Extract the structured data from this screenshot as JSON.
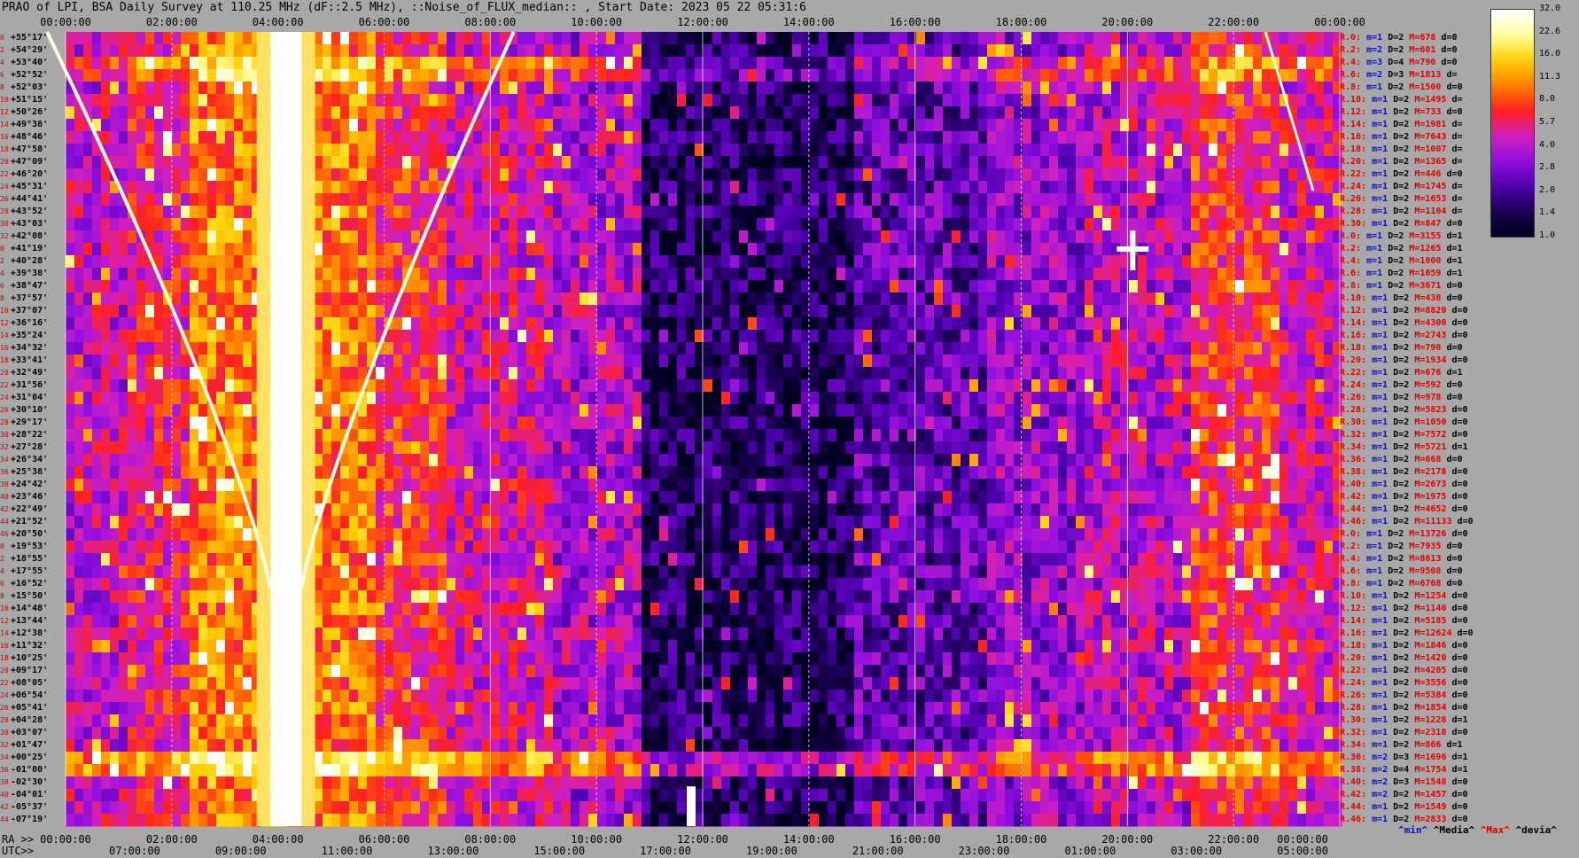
{
  "chart_data": {
    "type": "heatmap",
    "title": "PRAO of LPI, BSA Daily Survey at 110.25 MHz (dF::2.5 MHz), ::Noise_of_FLUX_median:: , Start Date: 2023 05 22 05:31:6",
    "x_top_ticks": [
      "00:00:00",
      "02:00:00",
      "04:00:00",
      "06:00:00",
      "08:00:00",
      "10:00:00",
      "12:00:00",
      "14:00:00",
      "16:00:00",
      "18:00:00",
      "20:00:00",
      "22:00:00",
      "00:00:00"
    ],
    "ra_axis_label": "RA >>",
    "ra_ticks": [
      "00:00:00",
      "02:00:00",
      "04:00:00",
      "06:00:00",
      "08:00:00",
      "10:00:00",
      "12:00:00",
      "14:00:00",
      "16:00:00",
      "18:00:00",
      "20:00:00",
      "22:00:00",
      "00:00:00"
    ],
    "utc_axis_label": "UTC>>",
    "utc_ticks": [
      "07:00:00",
      "09:00:00",
      "11:00:00",
      "13:00:00",
      "15:00:00",
      "17:00:00",
      "19:00:00",
      "21:00:00",
      "23:00:00",
      "01:00:00",
      "03:00:00",
      "05:00:00"
    ],
    "declinations": [
      "+55°17'",
      "+54°29'",
      "+53°40'",
      "+52°52'",
      "+52°03'",
      "+51°15'",
      "+50°26'",
      "+49°38'",
      "+48°46'",
      "+47°58'",
      "+47°09'",
      "+46°20'",
      "+45°31'",
      "+44°41'",
      "+43°52'",
      "+43°03'",
      "+42°08'",
      "+41°19'",
      "+40°28'",
      "+39°38'",
      "+38°47'",
      "+37°57'",
      "+37°07'",
      "+36°16'",
      "+35°24'",
      "+34°32'",
      "+33°41'",
      "+32°49'",
      "+31°56'",
      "+31°04'",
      "+30°10'",
      "+29°17'",
      "+28°22'",
      "+27°28'",
      "+26°34'",
      "+25°38'",
      "+24°42'",
      "+23°46'",
      "+22°49'",
      "+21°52'",
      "+20°50'",
      "+19°53'",
      "+18°55'",
      "+17°55'",
      "+16°52'",
      "+15°50'",
      "+14°48'",
      "+13°44'",
      "+12°38'",
      "+11°32'",
      "+10°25'",
      "+09°17'",
      "+08°05'",
      "+06°54'",
      "+05°41'",
      "+04°28'",
      "+03°07'",
      "+01°47'",
      "+00°25'",
      "-01°00'",
      "-02°30'",
      "-04°01'",
      "-05°37'",
      "-07°19'"
    ],
    "row_numbers": [
      "0",
      "2",
      "4",
      "6",
      "8",
      "10",
      "12",
      "14",
      "16",
      "18",
      "20",
      "22",
      "24",
      "26",
      "28",
      "30",
      "32",
      "0",
      "2",
      "4",
      "6",
      "8",
      "10",
      "12",
      "14",
      "16",
      "18",
      "20",
      "22",
      "24",
      "26",
      "28",
      "30",
      "32",
      "34",
      "36",
      "38",
      "40",
      "42",
      "44",
      "46",
      "0",
      "2",
      "4",
      "6",
      "8",
      "10",
      "12",
      "14",
      "16",
      "18",
      "20",
      "22",
      "24",
      "26",
      "28",
      "30",
      "32",
      "34",
      "36",
      "38",
      "40",
      "42",
      "44"
    ],
    "colorbar_ticks": [
      "32.0",
      "22.6",
      "16.0",
      "11.3",
      "8.0",
      "5.7",
      "4.0",
      "2.8",
      "2.0",
      "1.4",
      "1.0"
    ],
    "colorbar_range": [
      1.0,
      32.0
    ],
    "colorbar_scale": "log",
    "colormap_stops": [
      "#000020",
      "#1a0050",
      "#5000b0",
      "#9010e0",
      "#d020c0",
      "#ff2020",
      "#ff8000",
      "#ffd000",
      "#ffffa0",
      "#ffffff"
    ],
    "beams": [
      {
        "r": "R.0:",
        "m": "1",
        "D": "2",
        "M": "678",
        "d": "0"
      },
      {
        "r": "R.2:",
        "m": "2",
        "D": "2",
        "M": "601",
        "d": "0"
      },
      {
        "r": "R.4:",
        "m": "3",
        "D": "4",
        "M": "790",
        "d": "0"
      },
      {
        "r": "R.6:",
        "m": "2",
        "D": "3",
        "M": "1813",
        "d": ""
      },
      {
        "r": "R.8:",
        "m": "1",
        "D": "2",
        "M": "1500",
        "d": "0"
      },
      {
        "r": "R.10:",
        "m": "1",
        "D": "2",
        "M": "1495",
        "d": ""
      },
      {
        "r": "R.12:",
        "m": "1",
        "D": "2",
        "M": "733",
        "d": "0"
      },
      {
        "r": "R.14:",
        "m": "1",
        "D": "2",
        "M": "1981",
        "d": ""
      },
      {
        "r": "R.16:",
        "m": "1",
        "D": "2",
        "M": "7643",
        "d": ""
      },
      {
        "r": "R.18:",
        "m": "1",
        "D": "2",
        "M": "1007",
        "d": ""
      },
      {
        "r": "R.20:",
        "m": "1",
        "D": "2",
        "M": "1365",
        "d": ""
      },
      {
        "r": "R.22:",
        "m": "1",
        "D": "2",
        "M": "446",
        "d": "0"
      },
      {
        "r": "R.24:",
        "m": "1",
        "D": "2",
        "M": "1745",
        "d": ""
      },
      {
        "r": "R.26:",
        "m": "1",
        "D": "2",
        "M": "1653",
        "d": ""
      },
      {
        "r": "R.28:",
        "m": "1",
        "D": "2",
        "M": "1104",
        "d": ""
      },
      {
        "r": "R.30:",
        "m": "1",
        "D": "2",
        "M": "847",
        "d": "0"
      },
      {
        "r": "R.0:",
        "m": "1",
        "D": "2",
        "M": "3155",
        "d": "1"
      },
      {
        "r": "R.2:",
        "m": "1",
        "D": "2",
        "M": "1265",
        "d": "1"
      },
      {
        "r": "R.4:",
        "m": "1",
        "D": "2",
        "M": "1000",
        "d": "1"
      },
      {
        "r": "R.6:",
        "m": "1",
        "D": "2",
        "M": "1059",
        "d": "1"
      },
      {
        "r": "R.8:",
        "m": "1",
        "D": "2",
        "M": "3671",
        "d": "0"
      },
      {
        "r": "R.10:",
        "m": "1",
        "D": "2",
        "M": "438",
        "d": "0"
      },
      {
        "r": "R.12:",
        "m": "1",
        "D": "2",
        "M": "8820",
        "d": "0"
      },
      {
        "r": "R.14:",
        "m": "1",
        "D": "2",
        "M": "4300",
        "d": "0"
      },
      {
        "r": "R.16:",
        "m": "1",
        "D": "2",
        "M": "2743",
        "d": "0"
      },
      {
        "r": "R.18:",
        "m": "1",
        "D": "2",
        "M": "790",
        "d": "0"
      },
      {
        "r": "R.20:",
        "m": "1",
        "D": "2",
        "M": "1934",
        "d": "0"
      },
      {
        "r": "R.22:",
        "m": "1",
        "D": "2",
        "M": "676",
        "d": "1"
      },
      {
        "r": "R.24:",
        "m": "1",
        "D": "2",
        "M": "592",
        "d": "0"
      },
      {
        "r": "R.26:",
        "m": "1",
        "D": "2",
        "M": "978",
        "d": "0"
      },
      {
        "r": "R.28:",
        "m": "1",
        "D": "2",
        "M": "5823",
        "d": "0"
      },
      {
        "r": "R.30:",
        "m": "1",
        "D": "2",
        "M": "1050",
        "d": "0"
      },
      {
        "r": "R.32:",
        "m": "1",
        "D": "2",
        "M": "7572",
        "d": "0"
      },
      {
        "r": "R.34:",
        "m": "1",
        "D": "2",
        "M": "5721",
        "d": "1"
      },
      {
        "r": "R.36:",
        "m": "1",
        "D": "2",
        "M": "668",
        "d": "0"
      },
      {
        "r": "R.38:",
        "m": "1",
        "D": "2",
        "M": "2178",
        "d": "0"
      },
      {
        "r": "R.40:",
        "m": "1",
        "D": "2",
        "M": "2673",
        "d": "0"
      },
      {
        "r": "R.42:",
        "m": "1",
        "D": "2",
        "M": "1975",
        "d": "0"
      },
      {
        "r": "R.44:",
        "m": "1",
        "D": "2",
        "M": "4652",
        "d": "0"
      },
      {
        "r": "R.46:",
        "m": "1",
        "D": "2",
        "M": "11133",
        "d": "0"
      },
      {
        "r": "R.0:",
        "m": "1",
        "D": "2",
        "M": "13726",
        "d": "0"
      },
      {
        "r": "R.2:",
        "m": "1",
        "D": "2",
        "M": "7935",
        "d": "0"
      },
      {
        "r": "R.4:",
        "m": "1",
        "D": "2",
        "M": "8613",
        "d": "0"
      },
      {
        "r": "R.6:",
        "m": "1",
        "D": "2",
        "M": "9508",
        "d": "0"
      },
      {
        "r": "R.8:",
        "m": "1",
        "D": "2",
        "M": "6768",
        "d": "0"
      },
      {
        "r": "R.10:",
        "m": "1",
        "D": "2",
        "M": "1254",
        "d": "0"
      },
      {
        "r": "R.12:",
        "m": "1",
        "D": "2",
        "M": "1140",
        "d": "0"
      },
      {
        "r": "R.14:",
        "m": "1",
        "D": "2",
        "M": "5185",
        "d": "0"
      },
      {
        "r": "R.16:",
        "m": "1",
        "D": "2",
        "M": "12624",
        "d": "0"
      },
      {
        "r": "R.18:",
        "m": "1",
        "D": "2",
        "M": "1846",
        "d": "0"
      },
      {
        "r": "R.20:",
        "m": "1",
        "D": "2",
        "M": "1420",
        "d": "0"
      },
      {
        "r": "R.22:",
        "m": "1",
        "D": "2",
        "M": "4205",
        "d": "0"
      },
      {
        "r": "R.24:",
        "m": "1",
        "D": "2",
        "M": "3556",
        "d": "0"
      },
      {
        "r": "R.26:",
        "m": "1",
        "D": "2",
        "M": "5384",
        "d": "0"
      },
      {
        "r": "R.28:",
        "m": "1",
        "D": "2",
        "M": "1854",
        "d": "0"
      },
      {
        "r": "R.30:",
        "m": "1",
        "D": "2",
        "M": "1228",
        "d": "1"
      },
      {
        "r": "R.32:",
        "m": "1",
        "D": "2",
        "M": "2318",
        "d": "0"
      },
      {
        "r": "R.34:",
        "m": "1",
        "D": "2",
        "M": "866",
        "d": "1"
      },
      {
        "r": "R.36:",
        "m": "2",
        "D": "3",
        "M": "1696",
        "d": "1"
      },
      {
        "r": "R.38:",
        "m": "2",
        "D": "4",
        "M": "1754",
        "d": "1"
      },
      {
        "r": "R.40:",
        "m": "2",
        "D": "3",
        "M": "1548",
        "d": "0"
      },
      {
        "r": "R.42:",
        "m": "2",
        "D": "2",
        "M": "1457",
        "d": "0"
      },
      {
        "r": "R.44:",
        "m": "1",
        "D": "2",
        "M": "1549",
        "d": "0"
      },
      {
        "r": "R.46:",
        "m": "1",
        "D": "2",
        "M": "2833",
        "d": "0"
      }
    ],
    "legend": {
      "min": "^min^",
      "median": "^Media^",
      "max": "^Max^",
      "dev": "^devia^"
    },
    "beam_field_labels": {
      "m": "m=",
      "D": "D=",
      "M": "M=",
      "d": "d="
    }
  }
}
